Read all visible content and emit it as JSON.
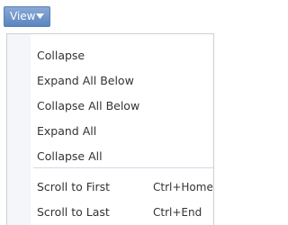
{
  "view_button": {
    "label": "View",
    "chevron_icon": "chevron-down-icon"
  },
  "menu": {
    "items": [
      {
        "label": "Collapse"
      },
      {
        "label": "Expand All Below"
      },
      {
        "label": "Collapse All Below"
      },
      {
        "label": "Expand All"
      },
      {
        "label": "Collapse All"
      }
    ],
    "scroll_items": [
      {
        "label": "Scroll to First",
        "shortcut": "Ctrl+Home"
      },
      {
        "label": "Scroll to Last",
        "shortcut": "Ctrl+End"
      }
    ]
  },
  "colors": {
    "button_top": "#8aa9d6",
    "button_bottom": "#5b85c0",
    "menu_text": "#333333",
    "menu_border": "#cfcfcf"
  }
}
